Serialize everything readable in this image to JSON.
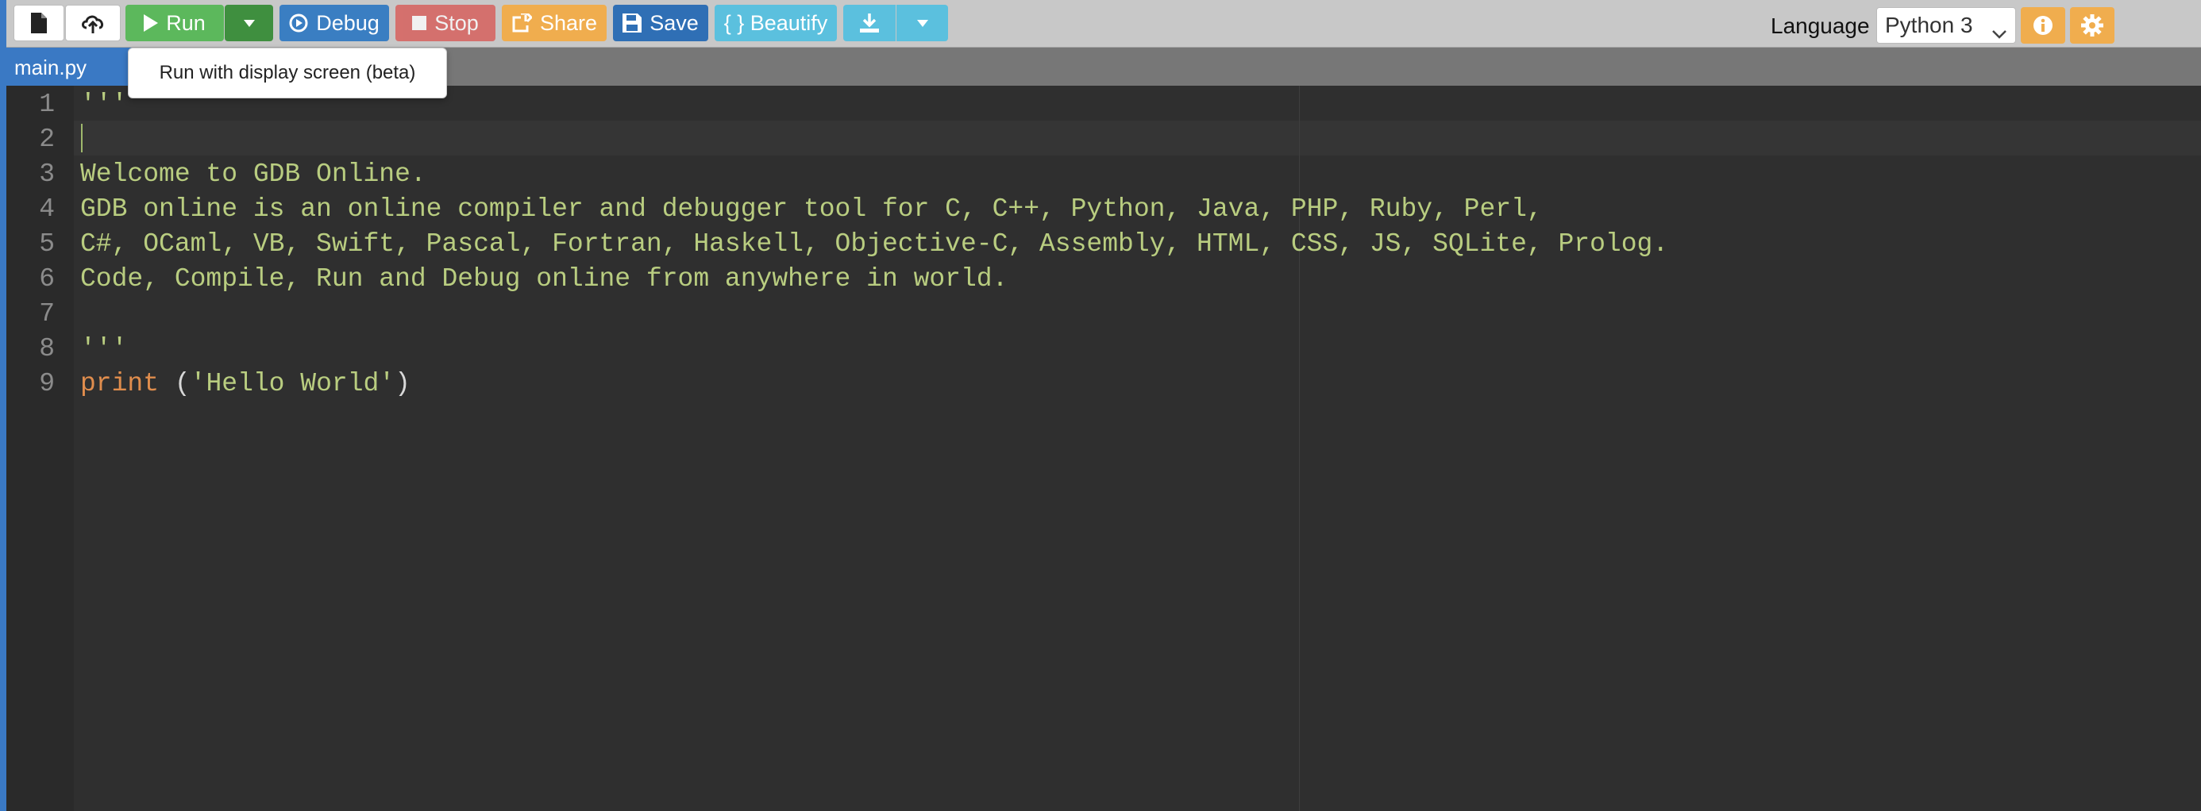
{
  "toolbar": {
    "new_file_icon": "file-icon",
    "upload_icon": "cloud-upload-icon",
    "run_label": "Run",
    "run_dropdown_icon": "caret-down-icon",
    "debug_label": "Debug",
    "stop_label": "Stop",
    "share_label": "Share",
    "save_label": "Save",
    "beautify_label": "{ } Beautify",
    "download_icon": "download-icon",
    "download_dropdown_icon": "caret-down-icon",
    "language_label": "Language",
    "language_value": "Python 3",
    "info_icon": "info-icon",
    "settings_icon": "gear-icon"
  },
  "tooltip": {
    "text": "Run with display screen (beta)"
  },
  "tabs": [
    {
      "label": "main.py"
    }
  ],
  "editor": {
    "line_numbers": [
      "1",
      "2",
      "3",
      "4",
      "5",
      "6",
      "7",
      "8",
      "9"
    ],
    "lines": [
      "'''",
      "",
      "Welcome to GDB Online.",
      "GDB online is an online compiler and debugger tool for C, C++, Python, Java, PHP, Ruby, Perl,",
      "C#, OCaml, VB, Swift, Pascal, Fortran, Haskell, Objective-C, Assembly, HTML, CSS, JS, SQLite, Prolog.",
      "Code, Compile, Run and Debug online from anywhere in world.",
      "",
      "'''",
      "print ('Hello World')"
    ],
    "line9_keyword": "print",
    "line9_space": " ",
    "line9_paren_open": "(",
    "line9_string": "'Hello World'",
    "line9_paren_close": ")"
  },
  "colors": {
    "run": "#5cb85c",
    "debug": "#3a7ec2",
    "stop": "#d9534f",
    "share": "#f0ad4e",
    "save": "#2f6fb5",
    "beautify": "#5bc0de",
    "editor_bg": "#2f2f2f",
    "code_text": "#b9cd80",
    "keyword": "#e08d4d"
  }
}
